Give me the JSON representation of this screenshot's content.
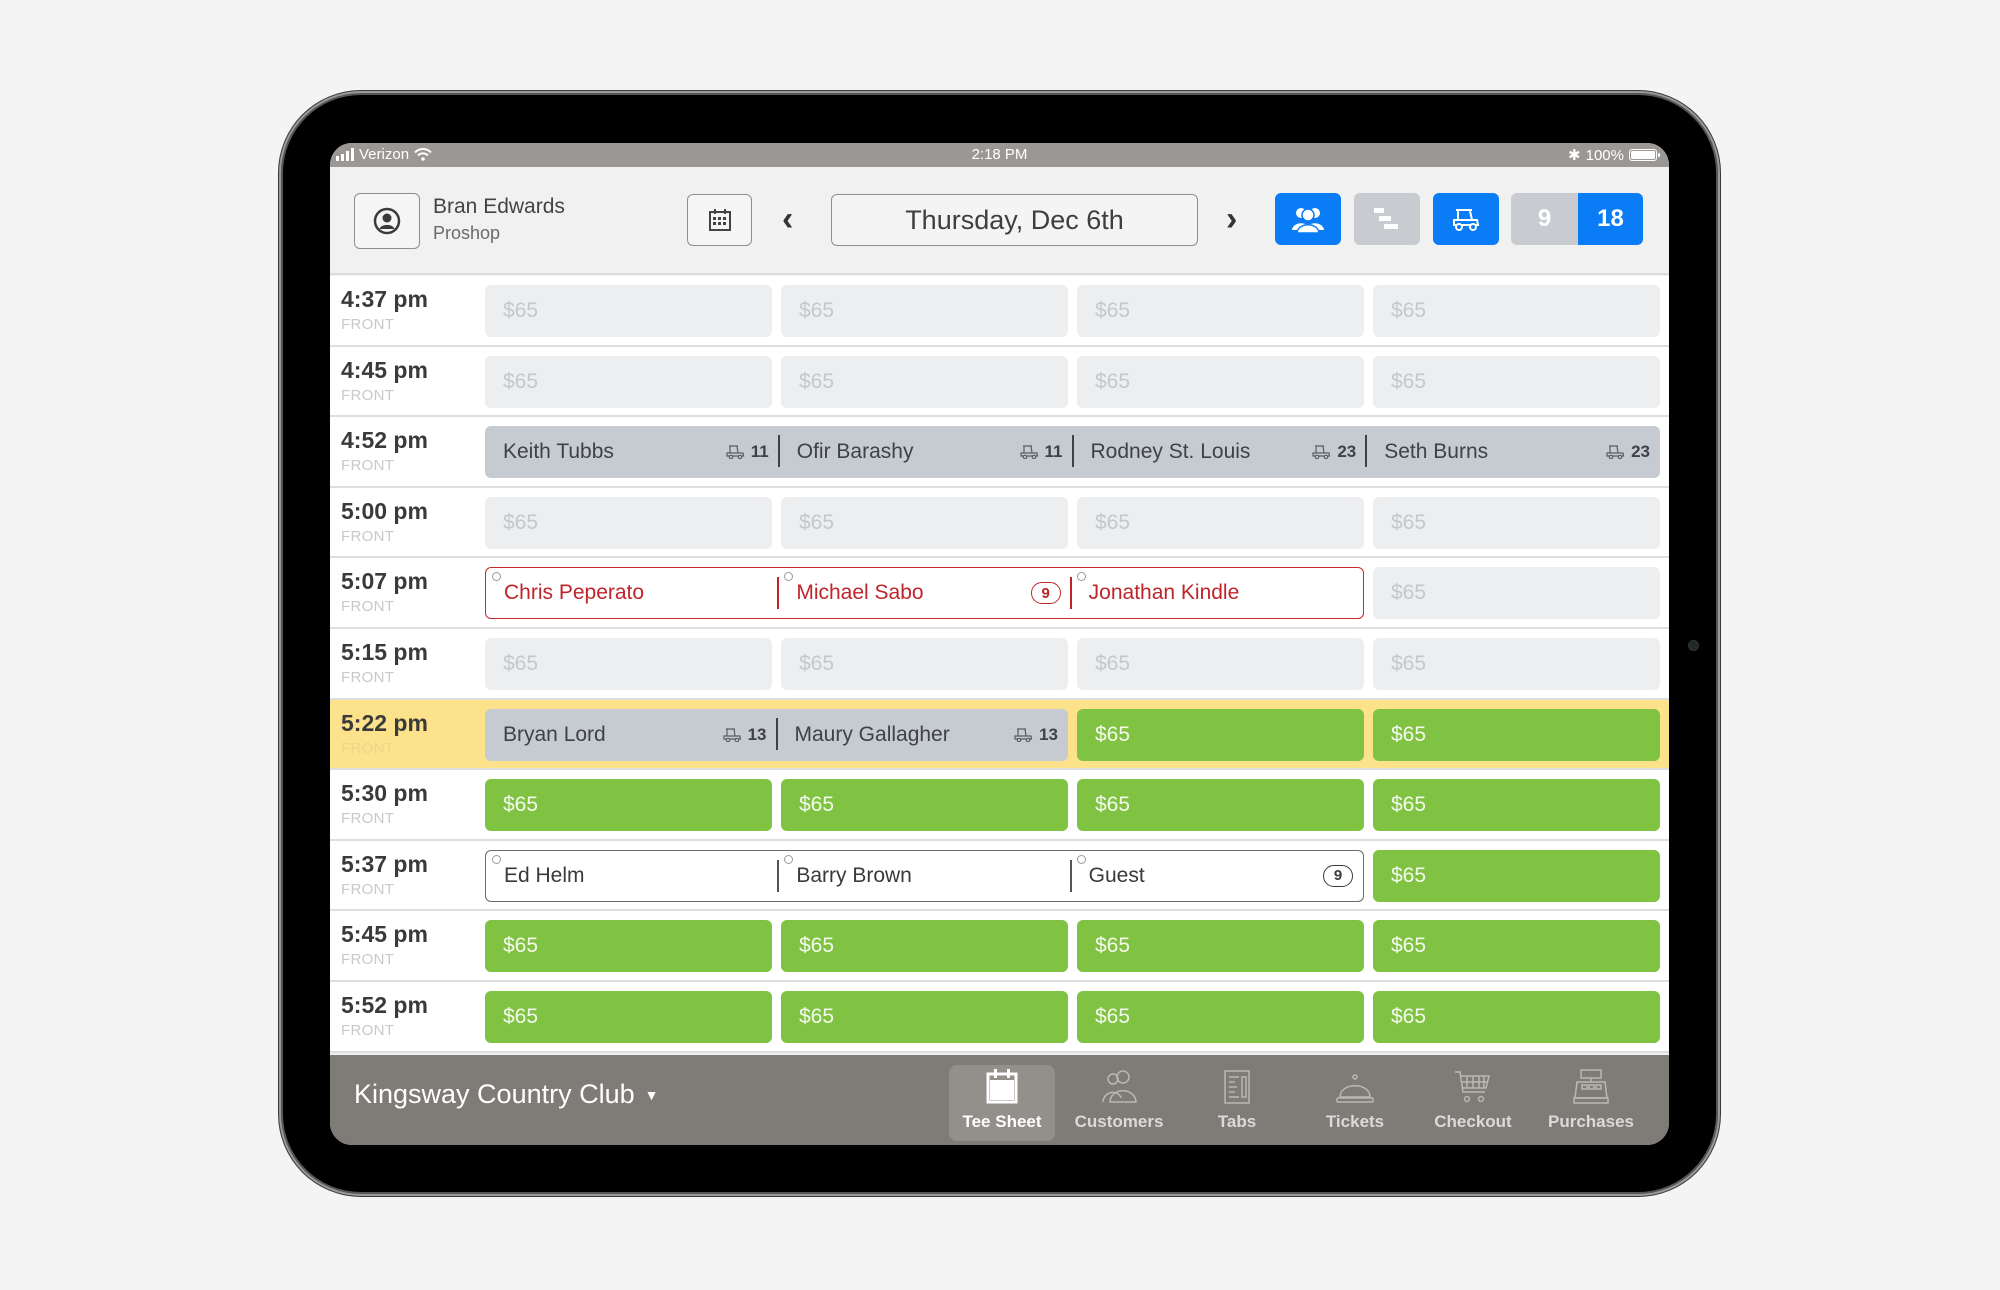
{
  "status_bar": {
    "carrier": "Verizon",
    "time": "2:18 PM",
    "battery": "100%"
  },
  "header": {
    "user_name": "Bran Edwards",
    "user_role": "Proshop",
    "date": "Thursday, Dec 6th",
    "holes_9": "9",
    "holes_18": "18",
    "selected_holes": "18",
    "toggles": {
      "players_view": "on",
      "tee_view": "off",
      "cart_view": "on"
    }
  },
  "colors": {
    "accent": "#0a7cf5",
    "available": "#80c241",
    "highlight": "#fbe28b",
    "booked_red": "#c0242b",
    "checked_in": "#c6cbd1"
  },
  "tee_sheet": [
    {
      "time": "4:37 pm",
      "course": "FRONT",
      "slots": [
        {
          "type": "open",
          "text": "$65"
        },
        {
          "type": "open",
          "text": "$65"
        },
        {
          "type": "open",
          "text": "$65"
        },
        {
          "type": "open",
          "text": "$65"
        }
      ]
    },
    {
      "time": "4:45 pm",
      "course": "FRONT",
      "slots": [
        {
          "type": "open",
          "text": "$65"
        },
        {
          "type": "open",
          "text": "$65"
        },
        {
          "type": "open",
          "text": "$65"
        },
        {
          "type": "open",
          "text": "$65"
        }
      ]
    },
    {
      "time": "4:52 pm",
      "course": "FRONT",
      "group": {
        "style": "checked",
        "span": 4,
        "players": [
          {
            "name": "Keith Tubbs",
            "cart": "11"
          },
          {
            "name": "Ofir Barashy",
            "cart": "11"
          },
          {
            "name": "Rodney St. Louis",
            "cart": "23"
          },
          {
            "name": "Seth Burns",
            "cart": "23"
          }
        ]
      },
      "slots": []
    },
    {
      "time": "5:00 pm",
      "course": "FRONT",
      "slots": [
        {
          "type": "open",
          "text": "$65"
        },
        {
          "type": "open",
          "text": "$65"
        },
        {
          "type": "open",
          "text": "$65"
        },
        {
          "type": "open",
          "text": "$65"
        }
      ]
    },
    {
      "time": "5:07 pm",
      "course": "FRONT",
      "group": {
        "style": "booked-red",
        "span": 3,
        "players": [
          {
            "name": "Chris Peperato"
          },
          {
            "name": "Michael Sabo",
            "nine": "9"
          },
          {
            "name": "Jonathan Kindle"
          }
        ]
      },
      "slots": [
        {
          "type": "open",
          "text": "$65"
        }
      ]
    },
    {
      "time": "5:15 pm",
      "course": "FRONT",
      "slots": [
        {
          "type": "open",
          "text": "$65"
        },
        {
          "type": "open",
          "text": "$65"
        },
        {
          "type": "open",
          "text": "$65"
        },
        {
          "type": "open",
          "text": "$65"
        }
      ]
    },
    {
      "time": "5:22 pm",
      "course": "FRONT",
      "highlight": true,
      "group": {
        "style": "checked",
        "span": 2,
        "players": [
          {
            "name": "Bryan Lord",
            "cart": "13"
          },
          {
            "name": "Maury Gallagher",
            "cart": "13"
          }
        ]
      },
      "slots": [
        {
          "type": "avail",
          "text": "$65"
        },
        {
          "type": "avail",
          "text": "$65"
        }
      ]
    },
    {
      "time": "5:30 pm",
      "course": "FRONT",
      "slots": [
        {
          "type": "avail",
          "text": "$65"
        },
        {
          "type": "avail",
          "text": "$65"
        },
        {
          "type": "avail",
          "text": "$65"
        },
        {
          "type": "avail",
          "text": "$65"
        }
      ]
    },
    {
      "time": "5:37 pm",
      "course": "FRONT",
      "group": {
        "style": "booked-dark",
        "span": 3,
        "players": [
          {
            "name": "Ed Helm"
          },
          {
            "name": "Barry Brown"
          },
          {
            "name": "Guest",
            "nine": "9"
          }
        ]
      },
      "slots": [
        {
          "type": "avail",
          "text": "$65"
        }
      ]
    },
    {
      "time": "5:45 pm",
      "course": "FRONT",
      "slots": [
        {
          "type": "avail",
          "text": "$65"
        },
        {
          "type": "avail",
          "text": "$65"
        },
        {
          "type": "avail",
          "text": "$65"
        },
        {
          "type": "avail",
          "text": "$65"
        }
      ]
    },
    {
      "time": "5:52 pm",
      "course": "FRONT",
      "slots": [
        {
          "type": "avail",
          "text": "$65"
        },
        {
          "type": "avail",
          "text": "$65"
        },
        {
          "type": "avail",
          "text": "$65"
        },
        {
          "type": "avail",
          "text": "$65"
        }
      ]
    }
  ],
  "tab_bar": {
    "club_name": "Kingsway Country Club",
    "tabs": [
      {
        "label": "Tee Sheet",
        "icon": "calendar-icon",
        "active": true
      },
      {
        "label": "Customers",
        "icon": "customers-icon",
        "active": false
      },
      {
        "label": "Tabs",
        "icon": "receipt-icon",
        "active": false
      },
      {
        "label": "Tickets",
        "icon": "cloche-icon",
        "active": false
      },
      {
        "label": "Checkout",
        "icon": "cart-icon",
        "active": false
      },
      {
        "label": "Purchases",
        "icon": "register-icon",
        "active": false
      }
    ]
  }
}
